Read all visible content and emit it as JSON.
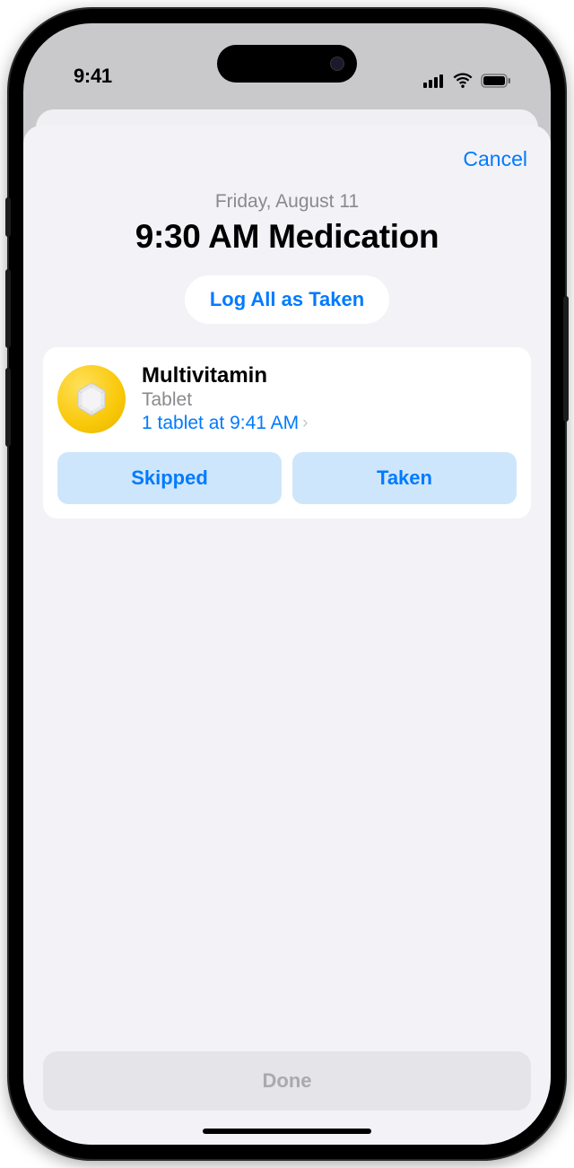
{
  "statusBar": {
    "time": "9:41"
  },
  "sheet": {
    "cancel": "Cancel",
    "date": "Friday, August 11",
    "title": "9:30 AM Medication",
    "logAll": "Log All as Taken",
    "doneLabel": "Done"
  },
  "medication": {
    "name": "Multivitamin",
    "form": "Tablet",
    "dose": "1 tablet at 9:41 AM",
    "skippedLabel": "Skipped",
    "takenLabel": "Taken"
  },
  "colors": {
    "iosBlue": "#007aff",
    "sheetBg": "#f2f2f7"
  }
}
